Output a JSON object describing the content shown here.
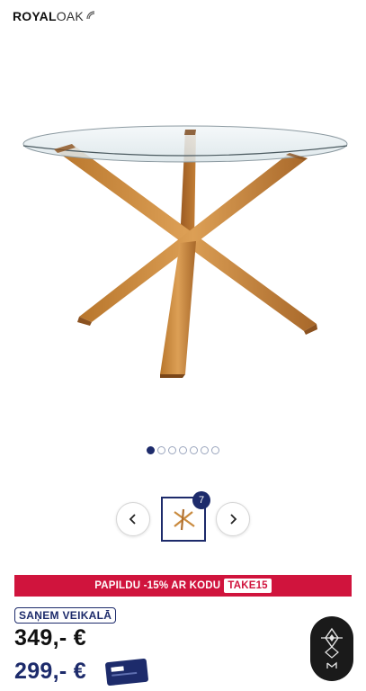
{
  "brand": {
    "name_bold": "ROYAL",
    "name_light": "OAK"
  },
  "gallery": {
    "image_icon": "glass-table-with-oak-legs",
    "slides_total": 7,
    "active_index": 0,
    "thumb_count_badge": "7"
  },
  "nav": {
    "prev_icon": "chevron-left-icon",
    "next_icon": "chevron-right-icon"
  },
  "promo": {
    "text": "PAPILDU -15% AR KODU",
    "code": "TAKE15"
  },
  "pickup": {
    "label": "SAŅEM VEIKALĀ"
  },
  "prices": {
    "regular": "349,-  €",
    "sale": "299,- €"
  },
  "colors": {
    "navy": "#1d2b6b",
    "promo_red": "#d0143d",
    "wood": "#c98a3e"
  }
}
